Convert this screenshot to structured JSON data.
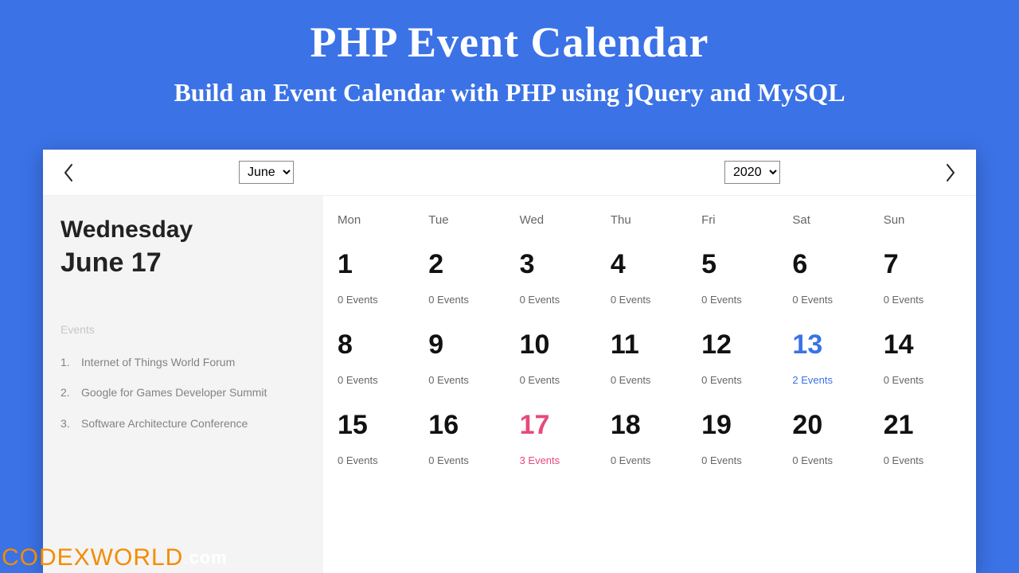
{
  "hero": {
    "title": "PHP Event Calendar",
    "subtitle": "Build an Event Calendar with PHP using jQuery and MySQL"
  },
  "watermark": {
    "brand": "CODEXWORLD",
    "tld": "com"
  },
  "topbar": {
    "month_value": "June",
    "year_value": "2020"
  },
  "sidebar": {
    "dow": "Wednesday",
    "date": "June 17",
    "events_header": "Events",
    "events": [
      "Internet of Things World Forum",
      "Google for Games Developer Summit",
      "Software Architecture Conference"
    ]
  },
  "calendar": {
    "day_labels": [
      "Mon",
      "Tue",
      "Wed",
      "Thu",
      "Fri",
      "Sat",
      "Sun"
    ],
    "weeks": [
      [
        {
          "n": "1",
          "ev": "0 Events"
        },
        {
          "n": "2",
          "ev": "0 Events"
        },
        {
          "n": "3",
          "ev": "0 Events"
        },
        {
          "n": "4",
          "ev": "0 Events"
        },
        {
          "n": "5",
          "ev": "0 Events"
        },
        {
          "n": "6",
          "ev": "0 Events"
        },
        {
          "n": "7",
          "ev": "0 Events"
        }
      ],
      [
        {
          "n": "8",
          "ev": "0 Events"
        },
        {
          "n": "9",
          "ev": "0 Events"
        },
        {
          "n": "10",
          "ev": "0 Events"
        },
        {
          "n": "11",
          "ev": "0 Events"
        },
        {
          "n": "12",
          "ev": "0 Events"
        },
        {
          "n": "13",
          "ev": "2 Events",
          "hl": "blue"
        },
        {
          "n": "14",
          "ev": "0 Events"
        }
      ],
      [
        {
          "n": "15",
          "ev": "0 Events"
        },
        {
          "n": "16",
          "ev": "0 Events"
        },
        {
          "n": "17",
          "ev": "3 Events",
          "hl": "pink"
        },
        {
          "n": "18",
          "ev": "0 Events"
        },
        {
          "n": "19",
          "ev": "0 Events"
        },
        {
          "n": "20",
          "ev": "0 Events"
        },
        {
          "n": "21",
          "ev": "0 Events"
        }
      ]
    ]
  }
}
